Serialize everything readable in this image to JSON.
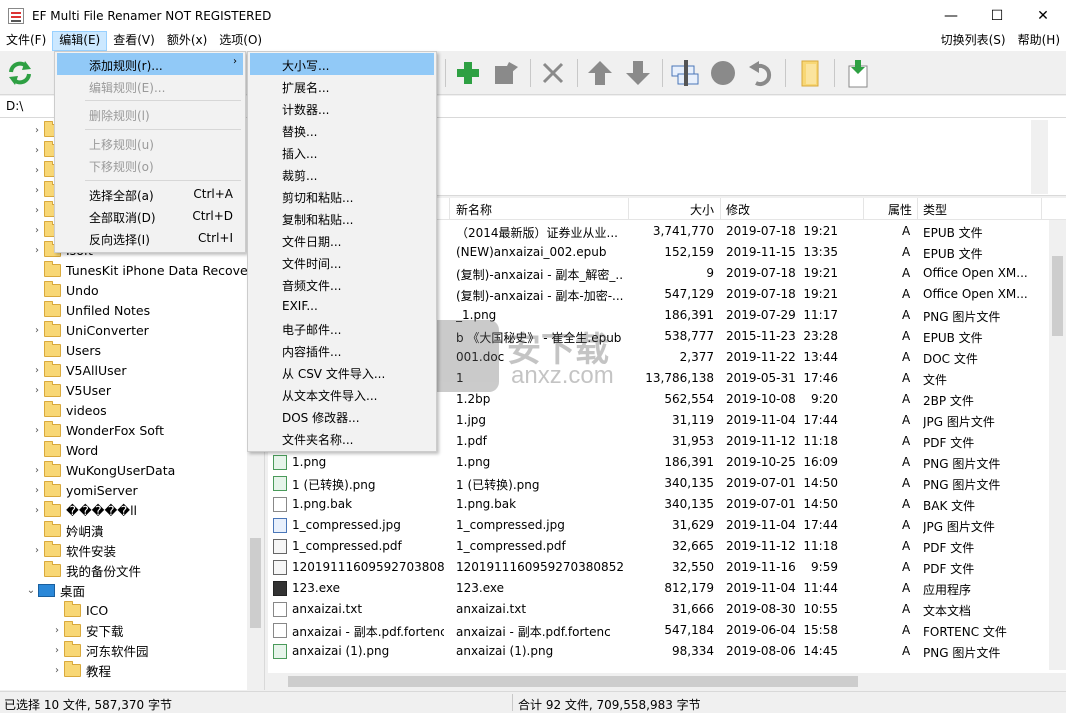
{
  "window": {
    "title": "EF Multi File Renamer NOT REGISTERED",
    "minimize": "—",
    "maximize": "☐",
    "close": "✕"
  },
  "menubar": {
    "items": [
      "文件(F)",
      "编辑(E)",
      "查看(V)",
      "额外(x)",
      "选项(O)"
    ],
    "right_items": [
      "切换列表(S)",
      "帮助(H)"
    ]
  },
  "address": {
    "path": "D:\\"
  },
  "tree": {
    "items": [
      "TunesKit iPhone Data Recovery",
      "Undo",
      "Unfiled Notes",
      "UniConverter",
      "Users",
      "V5AllUser",
      "V5User",
      "videos",
      "WonderFox Soft",
      "Word",
      "WuKongUserData",
      "yomiServer",
      "�����ll",
      "妗岄潰",
      "软件安装",
      "我的备份文件",
      "桌面",
      "ICO",
      "安下载",
      "河东软件园",
      "教程"
    ],
    "partial_label": "Isoft"
  },
  "file_list": {
    "columns": [
      "新名称",
      "大小",
      "修改",
      "属性",
      "类型"
    ],
    "rows": [
      {
        "name": "",
        "new_name": "（2014最新版）证券业从业...",
        "size": "3,741,770",
        "date": "2019-07-18",
        "time": "19:21",
        "attr": "A",
        "type": "EPUB 文件",
        "icon": "doc"
      },
      {
        "name": "",
        "new_name": "(NEW)anxaizai_002.epub",
        "size": "152,159",
        "date": "2019-11-15",
        "time": "13:35",
        "attr": "A",
        "type": "EPUB 文件",
        "icon": "doc"
      },
      {
        "name": "",
        "new_name": "(复制)-anxaizai - 副本_解密_...",
        "size": "9",
        "date": "2019-07-18",
        "time": "19:21",
        "attr": "A",
        "type": "Office Open XM...",
        "icon": "doc"
      },
      {
        "name": "",
        "new_name": "(复制)-anxaizai - 副本-加密-...",
        "size": "547,129",
        "date": "2019-07-18",
        "time": "19:21",
        "attr": "A",
        "type": "Office Open XM...",
        "icon": "doc"
      },
      {
        "name": "",
        "new_name": "_1.png",
        "size": "186,391",
        "date": "2019-07-29",
        "time": "11:17",
        "attr": "A",
        "type": "PNG 图片文件",
        "icon": "img"
      },
      {
        "name": "",
        "new_name": "b 《大国秘史》 - 崔全生.epub",
        "size": "538,777",
        "date": "2015-11-23",
        "time": "23:28",
        "attr": "A",
        "type": "EPUB 文件",
        "icon": "doc"
      },
      {
        "name": "",
        "new_name": "001.doc",
        "size": "2,377",
        "date": "2019-11-22",
        "time": "13:44",
        "attr": "A",
        "type": "DOC 文件",
        "icon": "doc"
      },
      {
        "name": "",
        "new_name": "1",
        "size": "13,786,138",
        "date": "2019-05-31",
        "time": "17:46",
        "attr": "A",
        "type": "文件",
        "icon": "doc"
      },
      {
        "name": "",
        "new_name": "1.2bp",
        "size": "562,554",
        "date": "2019-10-08",
        "time": "9:20",
        "attr": "A",
        "type": "2BP 文件",
        "icon": "doc"
      },
      {
        "name": "",
        "new_name": "1.jpg",
        "size": "31,119",
        "date": "2019-11-04",
        "time": "17:44",
        "attr": "A",
        "type": "JPG 图片文件",
        "icon": "jpg"
      },
      {
        "name": "",
        "new_name": "1.pdf",
        "size": "31,953",
        "date": "2019-11-12",
        "time": "11:18",
        "attr": "A",
        "type": "PDF 文件",
        "icon": "pdf"
      },
      {
        "name": "1.png",
        "new_name": "1.png",
        "size": "186,391",
        "date": "2019-10-25",
        "time": "16:09",
        "attr": "A",
        "type": "PNG 图片文件",
        "icon": "img"
      },
      {
        "name": "1 (已转换).png",
        "new_name": "1 (已转换).png",
        "size": "340,135",
        "date": "2019-07-01",
        "time": "14:50",
        "attr": "A",
        "type": "PNG 图片文件",
        "icon": "img"
      },
      {
        "name": "1.png.bak",
        "new_name": "1.png.bak",
        "size": "340,135",
        "date": "2019-07-01",
        "time": "14:50",
        "attr": "A",
        "type": "BAK 文件",
        "icon": "doc"
      },
      {
        "name": "1_compressed.jpg",
        "new_name": "1_compressed.jpg",
        "size": "31,629",
        "date": "2019-11-04",
        "time": "17:44",
        "attr": "A",
        "type": "JPG 图片文件",
        "icon": "jpg"
      },
      {
        "name": "1_compressed.pdf",
        "new_name": "1_compressed.pdf",
        "size": "32,665",
        "date": "2019-11-12",
        "time": "11:18",
        "attr": "A",
        "type": "PDF 文件",
        "icon": "pdf"
      },
      {
        "name": "1201911160959270380​8...",
        "new_name": "12019111609592703808​52...",
        "size": "32,550",
        "date": "2019-11-16",
        "time": "9:59",
        "attr": "A",
        "type": "PDF 文件",
        "icon": "pdf"
      },
      {
        "name": "123.exe",
        "new_name": "123.exe",
        "size": "812,179",
        "date": "2019-11-04",
        "time": "11:44",
        "attr": "A",
        "type": "应用程序",
        "icon": "exe"
      },
      {
        "name": "anxaizai.txt",
        "new_name": "anxaizai.txt",
        "size": "31,666",
        "date": "2019-08-30",
        "time": "10:55",
        "attr": "A",
        "type": "文本文档",
        "icon": "doc"
      },
      {
        "name": "anxaizai - 副本.pdf.fortenc",
        "new_name": "anxaizai - 副本.pdf.fortenc",
        "size": "547,184",
        "date": "2019-06-04",
        "time": "15:58",
        "attr": "A",
        "type": "FORTENC 文件",
        "icon": "doc"
      },
      {
        "name": "anxaizai (1).png",
        "new_name": "anxaizai (1).png",
        "size": "98,334",
        "date": "2019-08-06",
        "time": "14:45",
        "attr": "A",
        "type": "PNG 图片文件",
        "icon": "img"
      }
    ]
  },
  "edit_menu": {
    "items": [
      {
        "label": "添加规则(r)...",
        "shortcut": "",
        "disabled": false,
        "submenu": true
      },
      {
        "label": "编辑规则(E)...",
        "shortcut": "",
        "disabled": true
      },
      {
        "label": "删除规则(l)",
        "shortcut": "",
        "disabled": true
      },
      {
        "label": "上移规则(u)",
        "shortcut": "",
        "disabled": true
      },
      {
        "label": "下移规则(o)",
        "shortcut": "",
        "disabled": true
      },
      {
        "label": "选择全部(a)",
        "shortcut": "Ctrl+A",
        "disabled": false
      },
      {
        "label": "全部取消(D)",
        "shortcut": "Ctrl+D",
        "disabled": false
      },
      {
        "label": "反向选择(I)",
        "shortcut": "Ctrl+I",
        "disabled": false
      }
    ]
  },
  "add_rule_submenu": {
    "items": [
      "大小写...",
      "扩展名...",
      "计数器...",
      "替换...",
      "插入...",
      "裁剪...",
      "剪切和粘贴...",
      "复制和粘贴...",
      "文件日期...",
      "文件时间...",
      "音频文件...",
      "EXIF...",
      "电子邮件...",
      "内容插件...",
      "从 CSV 文件导入...",
      "从文本文件导入...",
      "DOS 修改器...",
      "文件夹名称..."
    ]
  },
  "status": {
    "selected": "已选择 10 文件, 587,370 字节",
    "total": "合计 92 文件, 709,558,983 字节"
  },
  "watermark": {
    "text": "安下载",
    "sub": "anxz.com"
  },
  "colors": {
    "highlight": "#91c9f7",
    "menu_active": "#cce8ff",
    "green_icon": "#2ea043",
    "gray_icon": "#6e6e6e"
  }
}
